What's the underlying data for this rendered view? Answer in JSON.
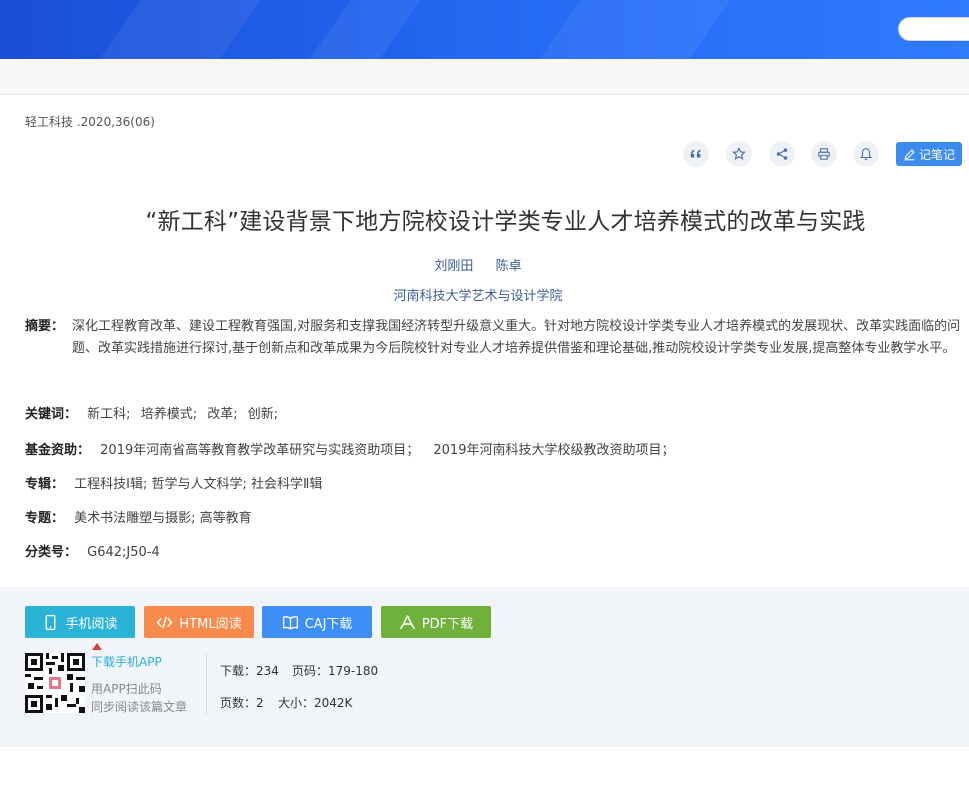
{
  "source": {
    "journal": "轻工科技",
    "issue": ".2020,36(06)"
  },
  "toolbar": {
    "note_label": "记笔记"
  },
  "article": {
    "title": "“新工科”建设背景下地方院校设计学类专业人才培养模式的改革与实践",
    "authors": [
      "刘刚田",
      "陈卓"
    ],
    "institution": "河南科技大学艺术与设计学院",
    "abstract_label": "摘要：",
    "abstract": "深化工程教育改革、建设工程教育强国,对服务和支撑我国经济转型升级意义重大。针对地方院校设计学类专业人才培养模式的发展现状、改革实践面临的问题、改革实践措施进行探讨,基于创新点和改革成果为今后院校针对专业人才培养提供借鉴和理论基础,推动院校设计学类专业发展,提高整体专业教学水平。",
    "keywords_label": "关键词：",
    "keywords": [
      "新工科;",
      "培养模式;",
      "改革;",
      "创新;"
    ],
    "fund_label": "基金资助：",
    "funds": [
      "2019年河南省高等教育教学改革研究与实践资助项目；",
      "2019年河南科技大学校级教改资助项目；"
    ],
    "album_label": "专辑：",
    "album": "工程科技Ⅰ辑; 哲学与人文科学; 社会科学Ⅱ辑",
    "topic_label": "专题：",
    "topic": "美术书法雕塑与摄影; 高等教育",
    "class_label": "分类号：",
    "class_no": "G642;J50-4"
  },
  "downloads": {
    "mobile": "手机阅读",
    "html": "HTML阅读",
    "caj": "CAJ下载",
    "pdf": "PDF下载"
  },
  "app": {
    "link": "下载手机APP",
    "hint1": "用APP扫此码",
    "hint2": "同步阅读该篇文章"
  },
  "stats": {
    "downloads_label": "下载：",
    "downloads": "234",
    "pages_label": "页码：",
    "pages": "179-180",
    "page_count_label": "页数：",
    "page_count": "2",
    "size_label": "大小：",
    "size": "2042K"
  },
  "colors": {
    "mobile": "#29b3d6",
    "html": "#f88b4c",
    "caj": "#3d8ef5",
    "pdf": "#6fb13a"
  },
  "icons": [
    "quote-icon",
    "star-icon",
    "share-icon",
    "print-icon",
    "bell-icon",
    "edit-icon",
    "phone-icon",
    "code-icon",
    "book-icon",
    "pdf-icon",
    "qr-code-icon"
  ]
}
